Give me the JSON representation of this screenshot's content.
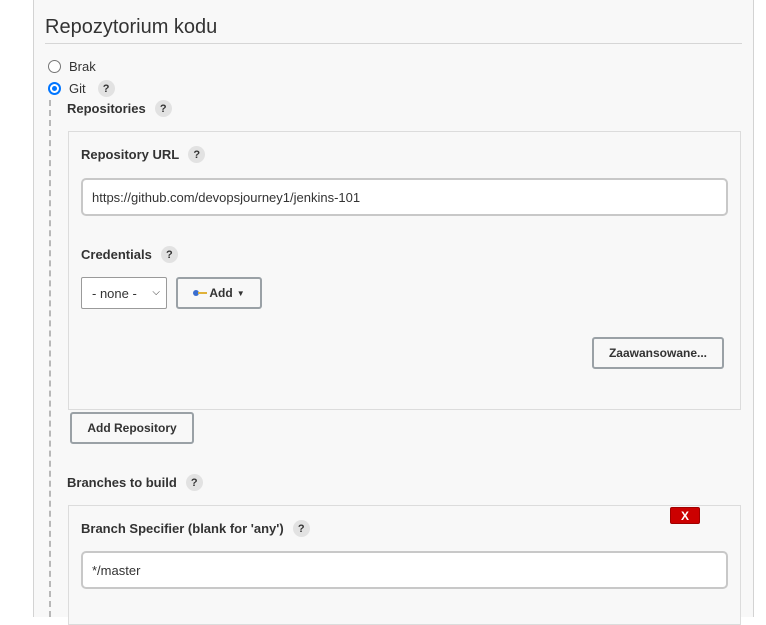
{
  "section": {
    "title": "Repozytorium kodu"
  },
  "scm_options": [
    {
      "label": "Brak",
      "checked": false
    },
    {
      "label": "Git",
      "checked": true
    }
  ],
  "help_label": "?",
  "repositories": {
    "title": "Repositories",
    "url_label": "Repository URL",
    "url_value": "https://github.com/devopsjourney1/jenkins-101",
    "credentials_label": "Credentials",
    "credentials_selected": "- none -",
    "add_label": "Add",
    "advanced_label": "Zaawansowane...",
    "add_repository_label": "Add Repository"
  },
  "branches": {
    "title": "Branches to build",
    "specifier_label": "Branch Specifier (blank for 'any')",
    "specifier_value": "*/master",
    "delete_label": "X"
  },
  "colors": {
    "accent": "#0075ff",
    "delete": "#cc0000",
    "panel_bg": "#f8f8f8"
  }
}
